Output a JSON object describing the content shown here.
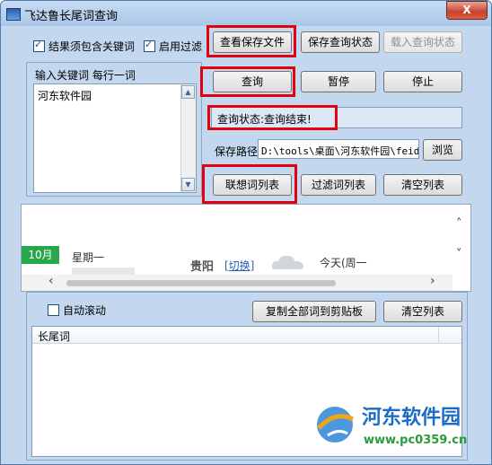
{
  "window": {
    "title": "飞达鲁长尾词查询",
    "close": "X"
  },
  "options": {
    "must_contain": "结果须包含关键词",
    "enable_filter": "启用过滤"
  },
  "top_buttons": {
    "view_saved": "查看保存文件",
    "save_state": "保存查询状态",
    "load_state": "载入查询状态"
  },
  "input": {
    "label": "输入关键词  每行一词",
    "keywords": "河东软件园"
  },
  "query_buttons": {
    "query": "查询",
    "pause": "暂停",
    "stop": "停止"
  },
  "status": {
    "text": "查询状态:查询结束!"
  },
  "save_path": {
    "label": "保存路径",
    "value": "D:\\tools\\桌面\\河东软件园\\feid",
    "browse": "浏览"
  },
  "list_buttons": {
    "related": "联想词列表",
    "filtered": "过滤词列表",
    "clear": "清空列表"
  },
  "web": {
    "month": "10月",
    "weekday": "星期一",
    "city": "贵阳",
    "switch": "[切换]",
    "today": "今天(周一"
  },
  "bottom": {
    "auto_scroll": "自动滚动",
    "copy_all": "复制全部词到剪贴板",
    "clear": "清空列表",
    "column": "长尾词"
  },
  "watermark": {
    "name": "河东软件园",
    "url": "www.pc0359.cn"
  }
}
